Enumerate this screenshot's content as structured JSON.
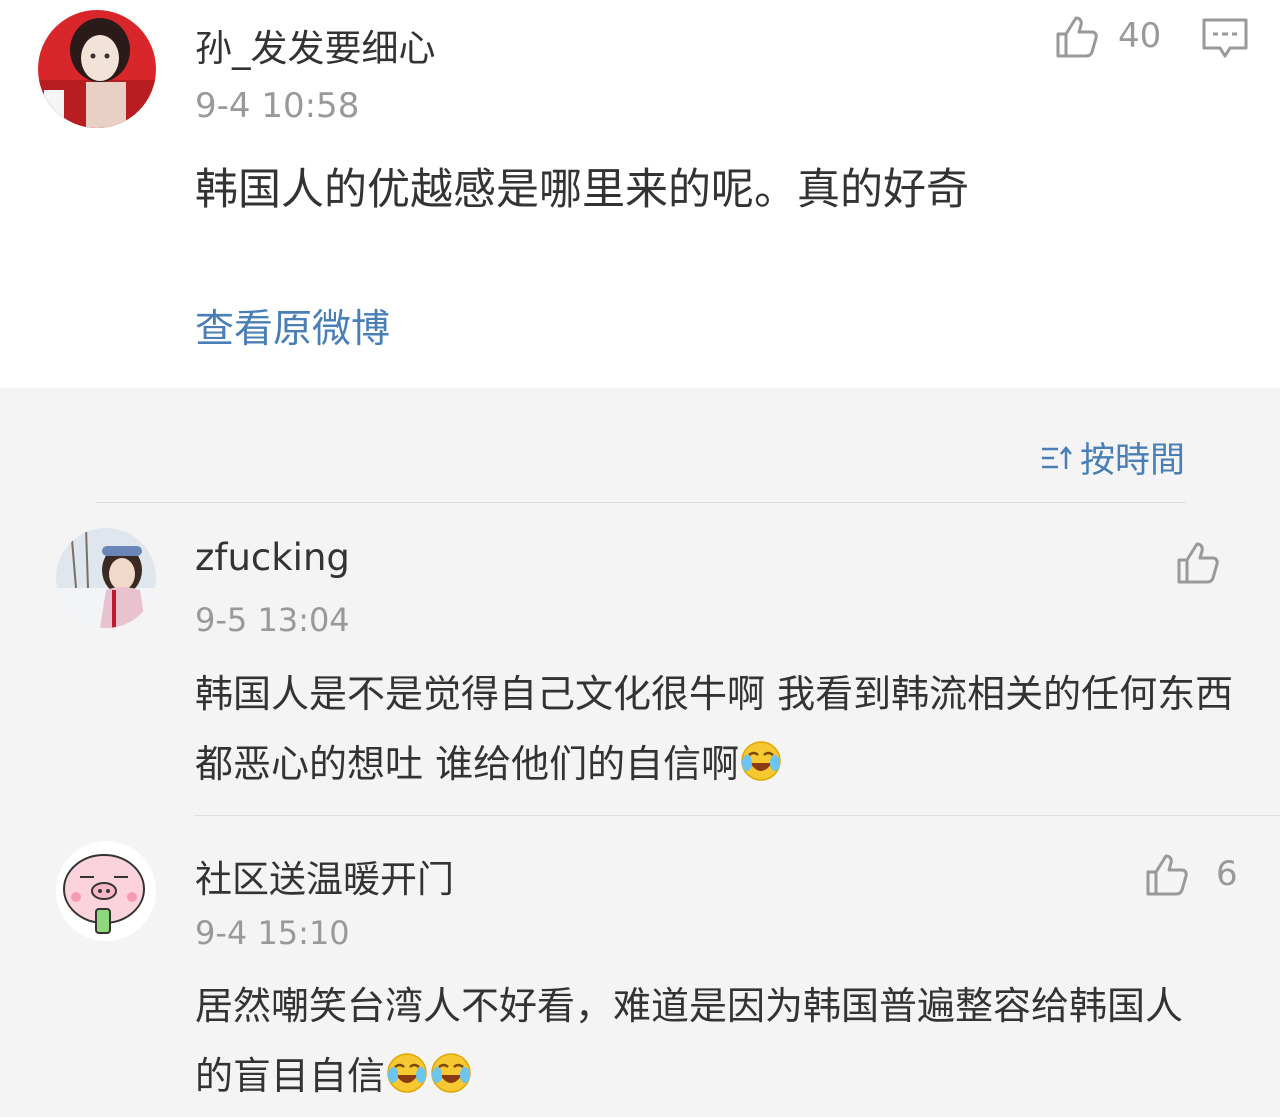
{
  "post": {
    "author": "孙_发发要细心",
    "time": "9-4 10:58",
    "text": "韩国人的优越感是哪里来的呢。真的好奇",
    "like_count": "40",
    "view_original": "查看原微博"
  },
  "sort": {
    "label": "按時間"
  },
  "comments": [
    {
      "author": "zfucking",
      "time": "9-5 13:04",
      "text": "韩国人是不是觉得自己文化很牛啊  我看到韩流相关的任何东西都恶心的想吐  谁给他们的自信啊",
      "emoji_count": 1,
      "like_count": ""
    },
    {
      "author": "社区送温暖开门",
      "time": "9-4 15:10",
      "text": "居然嘲笑台湾人不好看，难道是因为韩国普遍整容给韩国人的盲目自信",
      "emoji_count": 2,
      "like_count": "6"
    }
  ],
  "icons": {
    "like": "thumbs-up-icon",
    "comment": "comment-bubble-icon",
    "sort": "sort-icon",
    "emoji": "laugh-cry-emoji-icon"
  },
  "colors": {
    "link": "#4a7fb5",
    "secondary_text": "#999999",
    "primary_text": "#333333",
    "background": "#f4f4f4"
  }
}
